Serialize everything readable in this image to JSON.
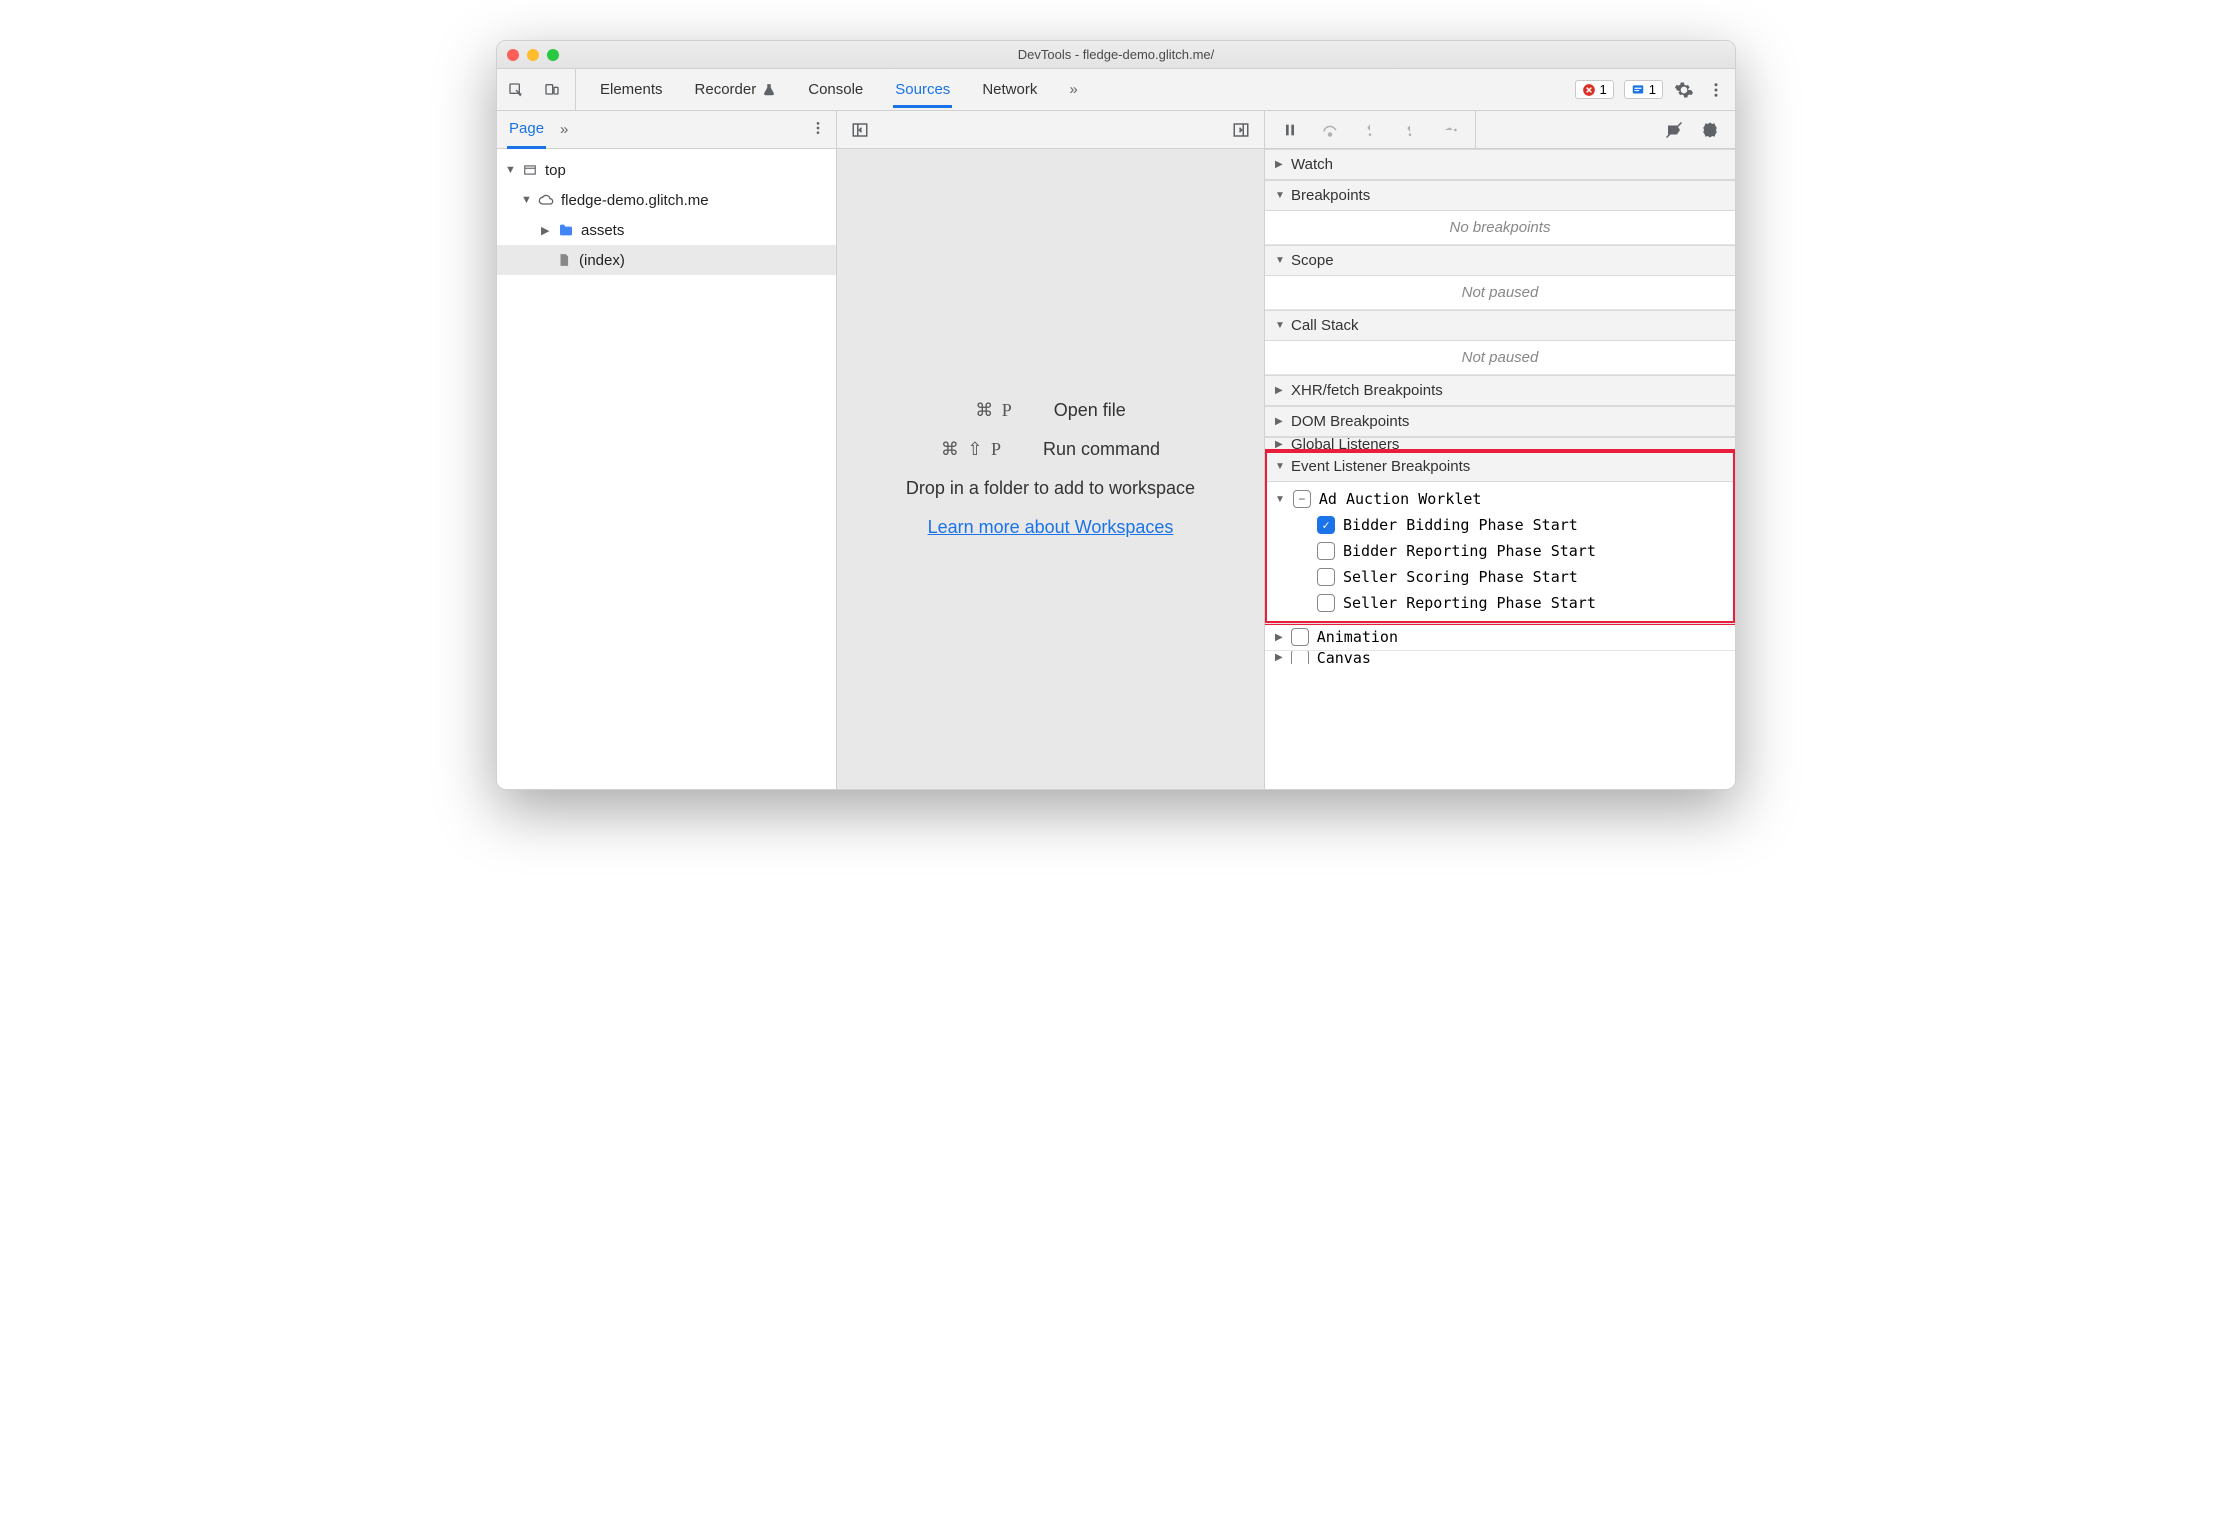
{
  "window": {
    "title": "DevTools - fledge-demo.glitch.me/"
  },
  "toolbar": {
    "tabs": [
      "Elements",
      "Recorder",
      "Console",
      "Sources",
      "Network"
    ],
    "active": "Sources",
    "error_count": "1",
    "message_count": "1"
  },
  "nav": {
    "tab": "Page"
  },
  "tree": {
    "top": "top",
    "origin": "fledge-demo.glitch.me",
    "folder": "assets",
    "file": "(index)"
  },
  "middle": {
    "open_keys": "⌘ P",
    "open_label": "Open file",
    "run_keys": "⌘ ⇧ P",
    "run_label": "Run command",
    "drop": "Drop in a folder to add to workspace",
    "link": "Learn more about Workspaces"
  },
  "side": {
    "watch": "Watch",
    "breakpoints": "Breakpoints",
    "no_bp": "No breakpoints",
    "scope": "Scope",
    "not_paused1": "Not paused",
    "callstack": "Call Stack",
    "not_paused2": "Not paused",
    "xhr": "XHR/fetch Breakpoints",
    "dom": "DOM Breakpoints",
    "global": "Global Listeners",
    "elb": "Event Listener Breakpoints",
    "worklet": {
      "name": "Ad Auction Worklet",
      "items": [
        {
          "label": "Bidder Bidding Phase Start",
          "checked": true
        },
        {
          "label": "Bidder Reporting Phase Start",
          "checked": false
        },
        {
          "label": "Seller Scoring Phase Start",
          "checked": false
        },
        {
          "label": "Seller Reporting Phase Start",
          "checked": false
        }
      ]
    },
    "animation": "Animation",
    "canvas": "Canvas"
  }
}
